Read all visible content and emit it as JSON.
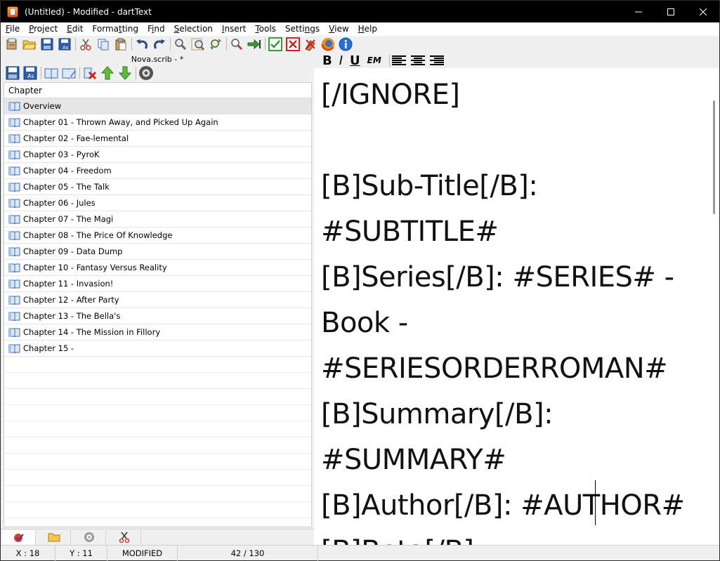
{
  "window": {
    "title": "(Untitled) - Modified - dartText"
  },
  "menu": [
    {
      "pre": "",
      "mn": "F",
      "post": "ile"
    },
    {
      "pre": "",
      "mn": "P",
      "post": "roject"
    },
    {
      "pre": "",
      "mn": "E",
      "post": "dit"
    },
    {
      "pre": "Forma",
      "mn": "t",
      "post": "ting"
    },
    {
      "pre": "F",
      "mn": "i",
      "post": "nd"
    },
    {
      "pre": "",
      "mn": "S",
      "post": "election"
    },
    {
      "pre": "",
      "mn": "I",
      "post": "nsert"
    },
    {
      "pre": "",
      "mn": "T",
      "post": "ools"
    },
    {
      "pre": "Setti",
      "mn": "n",
      "post": "gs"
    },
    {
      "pre": "",
      "mn": "V",
      "post": "iew"
    },
    {
      "pre": "",
      "mn": "H",
      "post": "elp"
    }
  ],
  "toolbar_icons": [
    "new-document-icon",
    "open-folder-icon",
    "save-icon",
    "save-as-icon",
    "cut-icon",
    "copy-icon",
    "paste-icon",
    "undo-icon",
    "redo-icon",
    "find-icon",
    "find-next-icon",
    "replace-icon",
    "zoom-icon",
    "go-to-icon",
    "check-icon",
    "close-x-icon",
    "clear-icon",
    "firefox-icon",
    "info-icon"
  ],
  "left_panel": {
    "title": "Nova.scrib - *",
    "column_header": "Chapter",
    "items": [
      "Overview",
      "Chapter 01 - Thrown Away, and Picked Up Again",
      "Chapter 02 - Fae-lemental",
      "Chapter 03 - PyroK",
      "Chapter 04 - Freedom",
      "Chapter 05 - The Talk",
      "Chapter 06 - Jules",
      "Chapter 07 - The Magi",
      "Chapter 08 - The Price Of Knowledge",
      "Chapter 09 - Data Dump",
      "Chapter 10 - Fantasy Versus Reality",
      "Chapter 11 - Invasion!",
      "Chapter 12 - After Party",
      "Chapter 13 - The Bella's",
      "Chapter 14 - The Mission in Fillory",
      "Chapter 15 -"
    ],
    "selected_index": 0
  },
  "format_bar": {
    "bold": "B",
    "italic": "I",
    "underline": "U",
    "em": "EM"
  },
  "editor": {
    "text": "[/IGNORE]\n\n[B]Sub-Title[/B]:\n#SUBTITLE#\n[B]Series[/B]: #SERIES# -\nBook -\n#SERIESORDERROMAN#\n[B]Summary[/B]:\n#SUMMARY#\n[B]Author[/B]: #AUTHOR#\n[B]Beta[/B]:"
  },
  "status": {
    "x": "X : 18",
    "y": "Y : 11",
    "state": "MODIFIED",
    "lines": "42 / 130"
  }
}
